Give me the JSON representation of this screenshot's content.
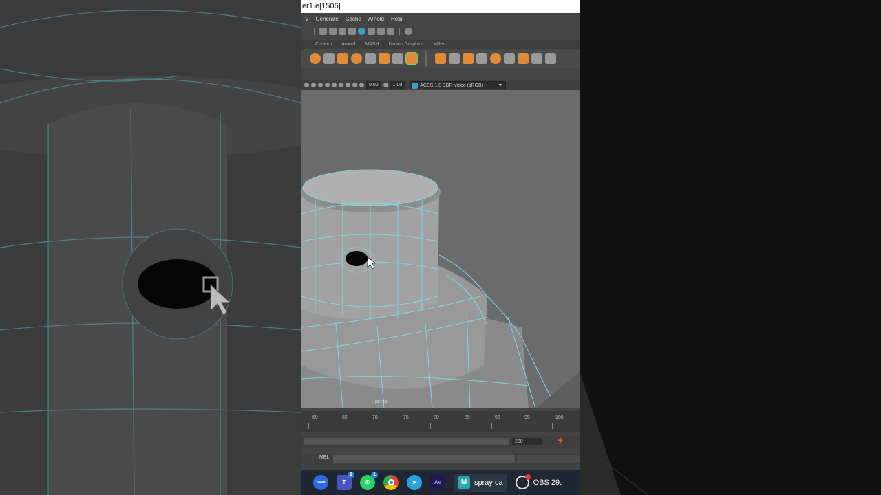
{
  "window": {
    "title": "er1.e[1506]"
  },
  "menu": {
    "items": [
      "V",
      "Generate",
      "Cache",
      "Arnold",
      "Help"
    ]
  },
  "shelf": {
    "tabs": [
      "Custom",
      "Arnold",
      "MASH",
      "Motion Graphics",
      "XGen"
    ]
  },
  "panel_toolbar": {
    "exposure": "0.00",
    "gamma": "1.00",
    "color_space": "ACES 1.0 SDR-video (sRGB)"
  },
  "viewport": {
    "camera_label": "persp"
  },
  "timeline": {
    "ticks": [
      "60",
      "65",
      "70",
      "75",
      "80",
      "85",
      "90",
      "95",
      "100"
    ]
  },
  "range": {
    "end_value": "200"
  },
  "command_line": {
    "label": "MEL"
  },
  "taskbar": {
    "zoom_label": "zoom",
    "teams_badge": "1",
    "whatsapp_badge": "1",
    "ae_label": "Ae",
    "maya_label": "spray ca",
    "maya_tile": "M",
    "obs_label": "OBS 29."
  },
  "colors": {
    "wireframe": "#7fd8e6",
    "accent_orange": "#e08b3a",
    "viewport_bg": "#6c6c6c"
  }
}
